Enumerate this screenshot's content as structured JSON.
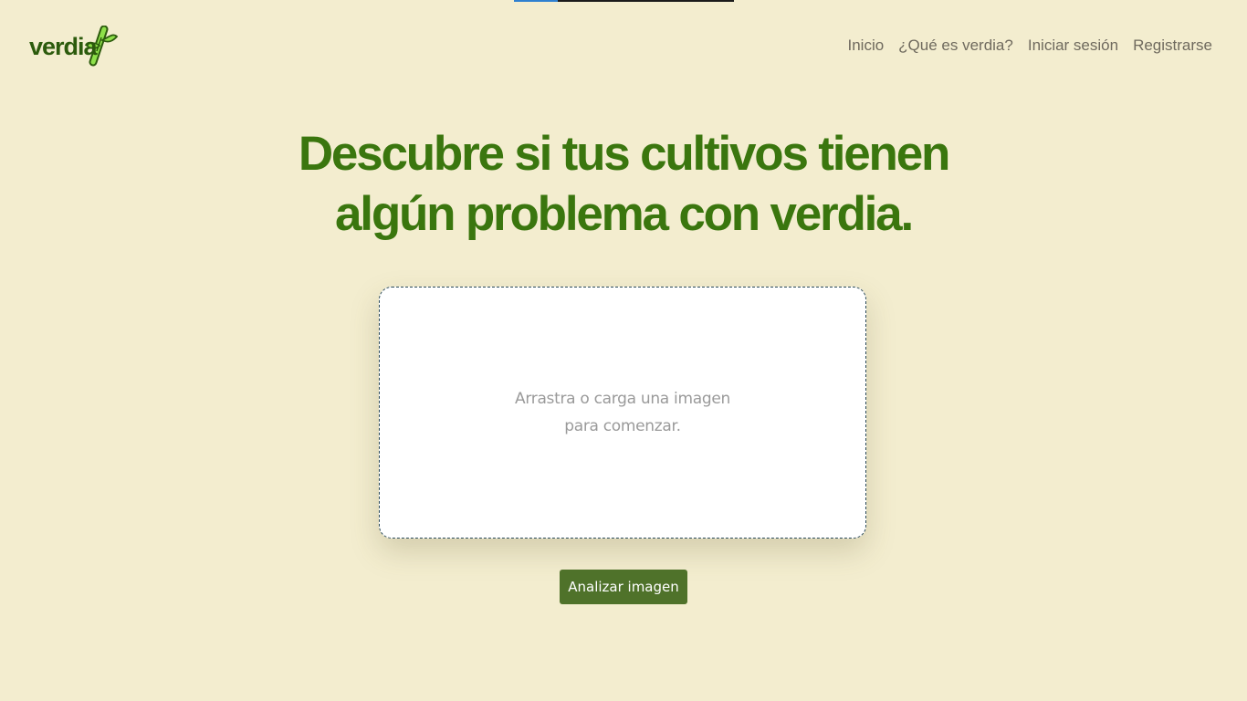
{
  "header": {
    "logo_text": "verdia",
    "nav": {
      "inicio": "Inicio",
      "que_es": "¿Qué es verdia?",
      "iniciar_sesion": "Iniciar sesión",
      "registrarse": "Registrarse"
    }
  },
  "loading_progress": 0.2,
  "hero": {
    "line1": "Descubre si tus cultivos tienen",
    "line2": "algún problema con verdia."
  },
  "dropzone": {
    "line1": "Arrastra o carga una imagen",
    "line2": "para comenzar."
  },
  "analyze_button": "Analizar imagen",
  "colors": {
    "background": "#f3edcf",
    "brand_green": "#3a760e",
    "button_green": "#4f722a",
    "logo_green": "#2c5b0d",
    "leaf_green": "#7fd33a"
  },
  "icons": {
    "logo": "bamboo-leaf-icon"
  }
}
